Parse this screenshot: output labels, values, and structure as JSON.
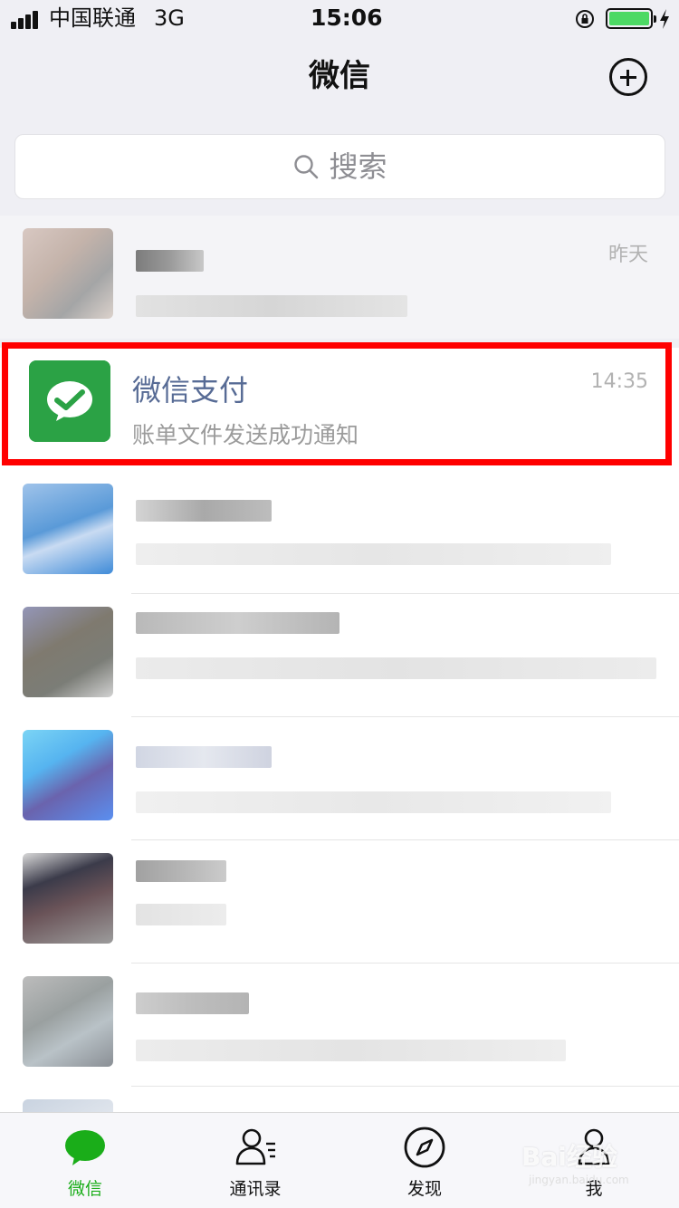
{
  "status_bar": {
    "carrier": "中国联通",
    "network": "3G",
    "time": "15:06",
    "battery_level": 1.0
  },
  "nav": {
    "title": "微信",
    "add_icon": "plus-circle-icon"
  },
  "search": {
    "label": "搜索",
    "icon": "search-icon"
  },
  "chats": [
    {
      "name": "",
      "preview": "",
      "time": "昨天",
      "blurred": true
    },
    {
      "name": "微信支付",
      "preview": "账单文件发送成功通知",
      "time": "14:35",
      "blurred": false,
      "highlighted": true
    },
    {
      "name": "",
      "preview": "",
      "time": "",
      "blurred": true
    },
    {
      "name": "",
      "preview": "",
      "time": "",
      "blurred": true
    },
    {
      "name": "",
      "preview": "",
      "time": "",
      "blurred": true
    },
    {
      "name": "",
      "preview": "",
      "time": "",
      "blurred": true
    },
    {
      "name": "",
      "preview": "",
      "time": "",
      "blurred": true
    },
    {
      "name": "",
      "preview": "",
      "time": "",
      "blurred": true
    }
  ],
  "tabs": [
    {
      "label": "微信",
      "icon": "chat-bubble-icon",
      "active": true
    },
    {
      "label": "通讯录",
      "icon": "contacts-icon",
      "active": false
    },
    {
      "label": "发现",
      "icon": "compass-icon",
      "active": false
    },
    {
      "label": "我",
      "icon": "person-icon",
      "active": false
    }
  ],
  "colors": {
    "accent": "#1aad19",
    "highlight": "#ff0000",
    "pay_green": "#2ba245",
    "name_blue": "#576b95"
  },
  "watermark": {
    "brand": "Bai经验",
    "domain": "jingyan.baidu.com"
  }
}
